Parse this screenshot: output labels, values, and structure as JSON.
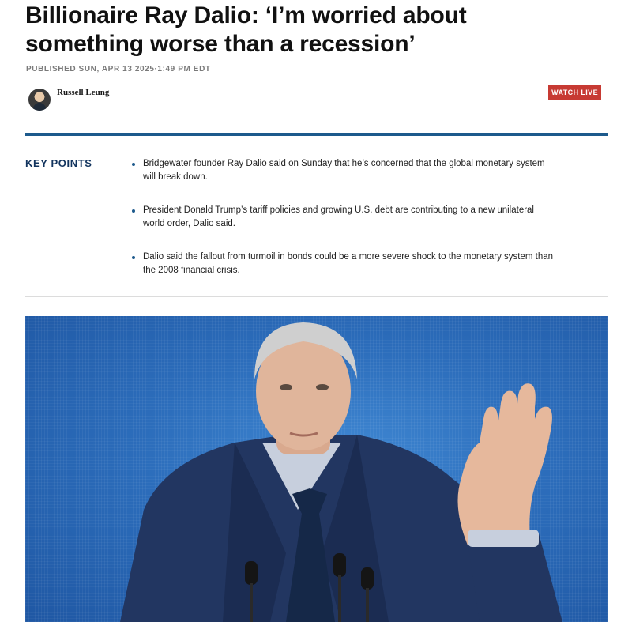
{
  "article": {
    "headline_line1": "Billionaire Ray Dalio: ‘I’m worried about",
    "headline_line2": "something worse than a recession’",
    "published": "PUBLISHED SUN, APR 13 2025·1:49 PM EDT",
    "author": "Russell Leung",
    "watch_live_label": "WATCH LIVE"
  },
  "key_points": {
    "title": "KEY POINTS",
    "items": [
      "Bridgewater founder Ray Dalio said on Sunday that he’s concerned that the global monetary system will break down.",
      "President Donald Trump’s tariff policies and growing U.S. debt are contributing to a new unilateral world order, Dalio said.",
      "Dalio said the fallout from turmoil in bonds could be a more severe shock to the monetary system than the 2008 financial crisis."
    ]
  },
  "colors": {
    "accent_blue": "#1d5a8c",
    "key_points_title": "#12345e",
    "watch_live_bg": "#c73a33",
    "photo_background": "#2c6dbb"
  },
  "icons": {
    "author_avatar": "author-avatar-photo"
  }
}
